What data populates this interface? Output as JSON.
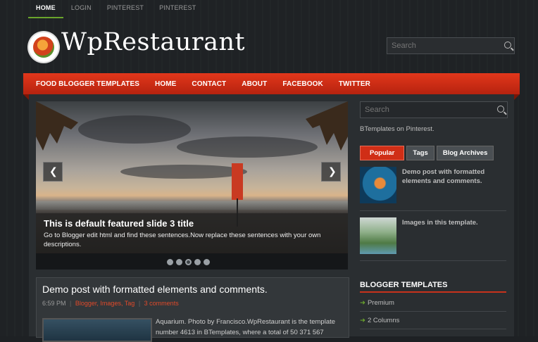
{
  "topnav": {
    "items": [
      "HOME",
      "LOGIN",
      "PINTEREST",
      "PINTEREST"
    ]
  },
  "header": {
    "logo_text": "WpRestaurant",
    "search_placeholder": "Search"
  },
  "mainnav": {
    "items": [
      "FOOD BLOGGER TEMPLATES",
      "HOME",
      "CONTACT",
      "ABOUT",
      "FACEBOOK",
      "TWITTER"
    ]
  },
  "slider": {
    "title": "This is default featured slide 3 title",
    "text": "Go to Blogger edit html and find these sentences.Now replace these sentences with your own descriptions.",
    "prev": "❮",
    "next": "❯",
    "active_dot": 3,
    "dot_count": 5
  },
  "post": {
    "title": "Demo post with formatted elements and comments.",
    "time": "6:59 PM",
    "sep": "|",
    "labels": "Blogger, Images, Tag",
    "comments": "3 comments",
    "excerpt": "Aquarium. Photo by Francisco.WpRestaurant is the template number 4613 in BTemplates, where a total of 50 371 567"
  },
  "sidebar": {
    "search_placeholder": "Search",
    "pinterest_text": "BTemplates on Pinterest.",
    "tabs": [
      "Popular",
      "Tags",
      "Blog Archives"
    ],
    "popular": [
      {
        "title": "Demo post with formatted elements and comments."
      },
      {
        "title": "Images in this template."
      }
    ],
    "section_title": "BLOGGER TEMPLATES",
    "section_items": [
      "Premium",
      "2 Columns"
    ]
  }
}
